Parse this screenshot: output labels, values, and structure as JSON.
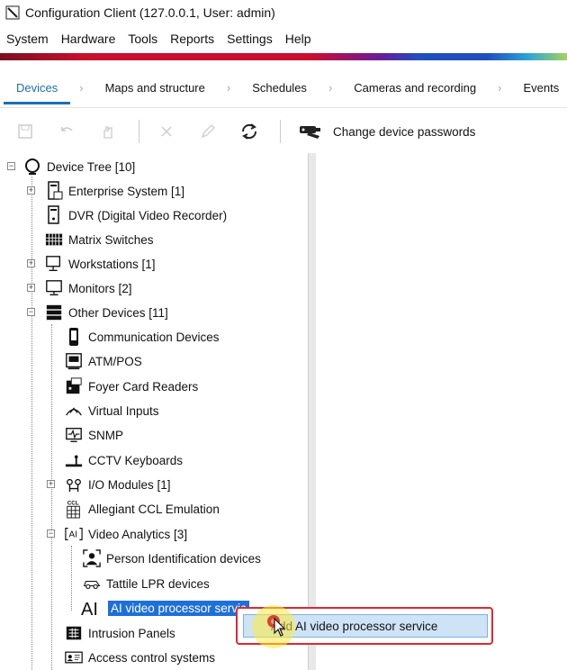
{
  "window": {
    "title": "Configuration Client (127.0.0.1, User: admin)"
  },
  "menu": [
    "System",
    "Hardware",
    "Tools",
    "Reports",
    "Settings",
    "Help"
  ],
  "nav": {
    "tabs": [
      "Devices",
      "Maps and structure",
      "Schedules",
      "Cameras and recording",
      "Events"
    ],
    "active": "Devices"
  },
  "toolbar": {
    "change_passwords_label": "Change device passwords"
  },
  "tree": {
    "root": "Device Tree [10]",
    "enterprise": "Enterprise System [1]",
    "dvr": "DVR (Digital Video Recorder)",
    "matrix": "Matrix Switches",
    "workstations": "Workstations [1]",
    "monitors": "Monitors [2]",
    "other": "Other Devices [11]",
    "comm": "Communication Devices",
    "atm": "ATM/POS",
    "foyer": "Foyer Card Readers",
    "virtual": "Virtual Inputs",
    "snmp": "SNMP",
    "cctv": "CCTV Keyboards",
    "io": "I/O Modules [1]",
    "allegiant": "Allegiant CCL Emulation",
    "va": "Video Analytics [3]",
    "person": "Person Identification devices",
    "tattile": "Tattile LPR devices",
    "ai": "AI video processor servic",
    "intrusion": "Intrusion Panels",
    "access": "Access control systems"
  },
  "context_menu": {
    "item": "Add AI video processor service"
  },
  "colors": {
    "accent": "#1b6fb5",
    "selection": "#1e6fd9",
    "highlight_border": "#e0282e"
  }
}
